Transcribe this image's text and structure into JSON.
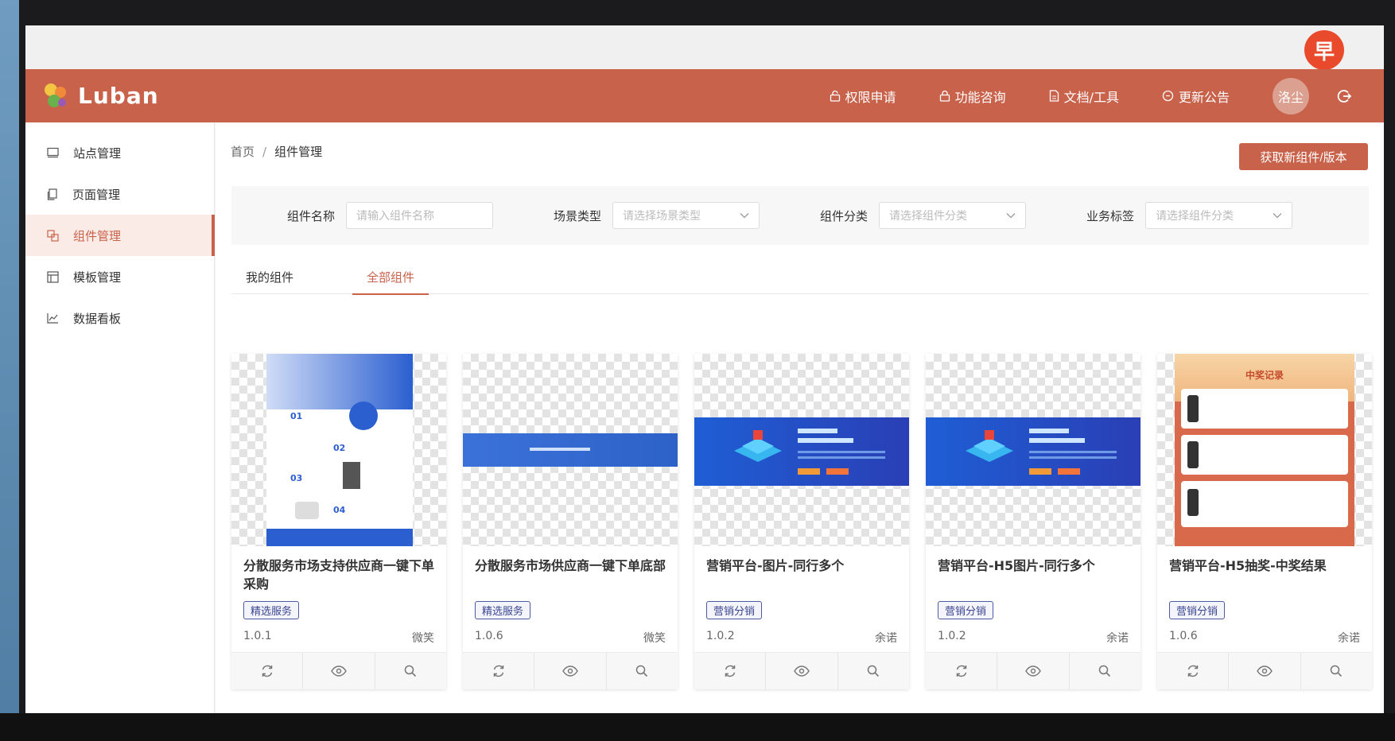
{
  "badge": "早",
  "app": {
    "logo_text": "Luban"
  },
  "topnav": [
    {
      "label": "权限申请",
      "icon": "lock-icon"
    },
    {
      "label": "功能咨询",
      "icon": "lock-icon"
    },
    {
      "label": "文档/工具",
      "icon": "document-icon"
    },
    {
      "label": "更新公告",
      "icon": "message-icon"
    }
  ],
  "user": {
    "avatar_text": "洛尘"
  },
  "sidebar": {
    "items": [
      {
        "label": "站点管理",
        "icon": "monitor-icon"
      },
      {
        "label": "页面管理",
        "icon": "pages-icon"
      },
      {
        "label": "组件管理",
        "icon": "component-icon",
        "active": true
      },
      {
        "label": "模板管理",
        "icon": "template-icon"
      },
      {
        "label": "数据看板",
        "icon": "chart-icon"
      }
    ]
  },
  "breadcrumb": {
    "home": "首页",
    "separator": "/",
    "current": "组件管理"
  },
  "actions": {
    "fetch_new_label": "获取新组件/版本"
  },
  "filters": {
    "name": {
      "label": "组件名称",
      "placeholder": "请输入组件名称"
    },
    "scene": {
      "label": "场景类型",
      "placeholder": "请选择场景类型"
    },
    "category": {
      "label": "组件分类",
      "placeholder": "请选择组件分类"
    },
    "tag": {
      "label": "业务标签",
      "placeholder": "请选择组件分类"
    }
  },
  "tabs": [
    {
      "label": "我的组件",
      "active": false
    },
    {
      "label": "全部组件",
      "active": true
    }
  ],
  "cards": [
    {
      "title": "分散服务市场支持供应商一键下单采购",
      "tag": "精选服务",
      "version": "1.0.1",
      "author": "微笑"
    },
    {
      "title": "分散服务市场供应商一键下单底部",
      "tag": "精选服务",
      "version": "1.0.6",
      "author": "微笑"
    },
    {
      "title": "营销平台-图片-同行多个",
      "tag": "营销分销",
      "version": "1.0.2",
      "author": "余诺"
    },
    {
      "title": "营销平台-H5图片-同行多个",
      "tag": "营销分销",
      "version": "1.0.2",
      "author": "余诺"
    },
    {
      "title": "营销平台-H5抽奖-中奖结果",
      "tag": "营销分销",
      "version": "1.0.6",
      "author": "余诺"
    }
  ],
  "thumbs": {
    "t5_title": "中奖记录"
  },
  "colors": {
    "brand": "#c9624b",
    "tag": "#4e5aa6",
    "badge": "#e94a2b"
  }
}
